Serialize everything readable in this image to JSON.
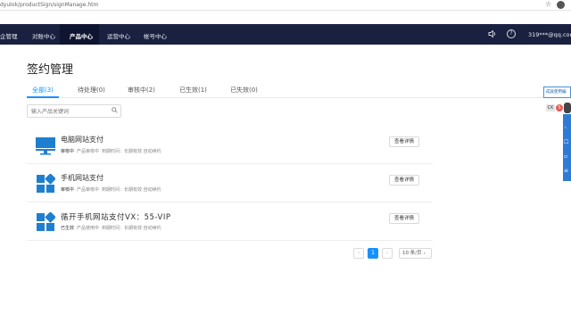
{
  "browser": {
    "url": "dyulok/productSign/signManage.htm"
  },
  "nav": {
    "items": [
      {
        "label": "企管理"
      },
      {
        "label": "对账中心"
      },
      {
        "label": "产品中心"
      },
      {
        "label": "运营中心"
      },
      {
        "label": "帐号中心"
      }
    ],
    "active_index": 2,
    "user": "319***@qq.com"
  },
  "page": {
    "title": "签约管理"
  },
  "tabs": [
    {
      "label": "全部(3)"
    },
    {
      "label": "待处理(0)"
    },
    {
      "label": "审核中(2)"
    },
    {
      "label": "已生效(1)"
    },
    {
      "label": "已失效(0)"
    }
  ],
  "search": {
    "placeholder": "输入产品关键词"
  },
  "products": [
    {
      "name": "电脑网站支付",
      "icon": "desktop-icon",
      "status": "审核中",
      "product_status": "产品审核中",
      "expiry": "到期时间：长期有效 自动续约",
      "button": "查看详情"
    },
    {
      "name": "手机网站支付",
      "icon": "windows-tiles-icon",
      "status": "审核中",
      "product_status": "产品审核中",
      "expiry": "到期时间：长期有效 自动续约",
      "button": "查看详情"
    },
    {
      "name": "循开手机网站支付VX：55-VIP",
      "icon": "windows-tiles-icon",
      "status": "已生效",
      "product_status": "产品使用中",
      "expiry": "到期时间：长期有效 自动续约",
      "button": "查看详情"
    }
  ],
  "pagination": {
    "current_page": "1",
    "page_size": "10 条/页"
  },
  "floating": {
    "tip": "成就使用编",
    "ck": "CK",
    "s": "S"
  },
  "colors": {
    "nav_bg": "#1a2140",
    "accent": "#1890ff",
    "icon_blue": "#1f7fcf"
  }
}
